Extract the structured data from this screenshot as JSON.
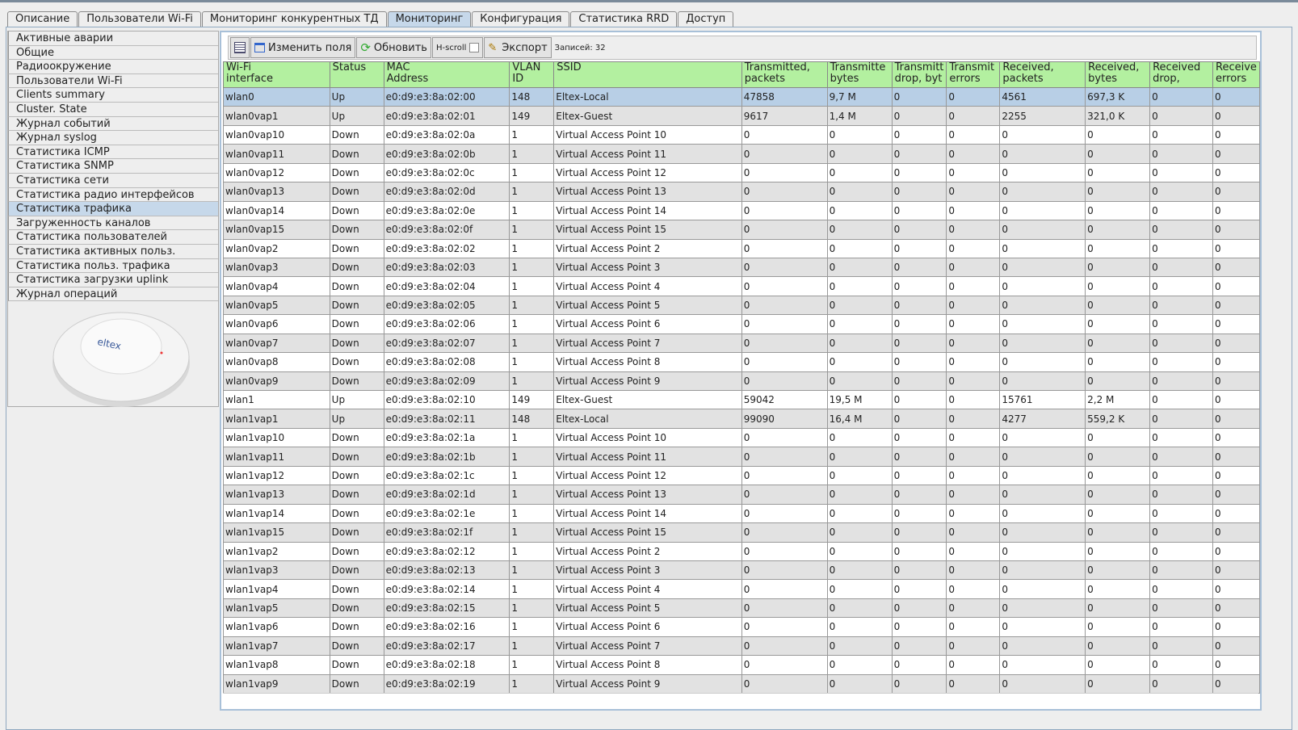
{
  "tabs": [
    "Описание",
    "Пользователи Wi-Fi",
    "Мониторинг конкурентных ТД",
    "Мониторинг",
    "Конфигурация",
    "Статистика RRD",
    "Доступ"
  ],
  "active_tab": 3,
  "sidebar": [
    "Активные аварии",
    "Общие",
    "Радиоокружение",
    "Пользователи Wi-Fi",
    "Clients summary",
    "Cluster. State",
    "Журнал событий",
    "Журнал syslog",
    "Статистика ICMP",
    "Статистика SNMP",
    "Статистика сети",
    "Статистика радио интерфейсов",
    "Статистика трафика",
    "Загруженность каналов",
    "Статистика пользователей",
    "Статистика активных польз.",
    "Статистика польз. трафика",
    "Статистика загрузки uplink",
    "Журнал операций"
  ],
  "sidebar_selected": 12,
  "device_logo": "ELTEX",
  "toolbar": {
    "edit_fields": "Изменить поля",
    "refresh": "Обновить",
    "hscroll": "H-scroll",
    "export": "Экспорт",
    "records": "Записей: 32"
  },
  "columns": [
    "Wi-Fi\ninterface",
    "Status",
    "MAC\nAddress",
    "VLAN\nID",
    "SSID",
    "Transmitted,\npackets",
    "Transmitte\nbytes",
    "Transmitt\ndrop, byt",
    "Transmit\nerrors",
    "Received,\npackets",
    "Received,\nbytes",
    "Received\ndrop,",
    "Receive\nerrors"
  ],
  "rows": [
    [
      "wlan0",
      "Up",
      "e0:d9:e3:8a:02:00",
      "148",
      "Eltex-Local",
      "47858",
      "9,7 M",
      "0",
      "0",
      "4561",
      "697,3 K",
      "0",
      "0"
    ],
    [
      "wlan0vap1",
      "Up",
      "e0:d9:e3:8a:02:01",
      "149",
      "Eltex-Guest",
      "9617",
      "1,4 M",
      "0",
      "0",
      "2255",
      "321,0 K",
      "0",
      "0"
    ],
    [
      "wlan0vap10",
      "Down",
      "e0:d9:e3:8a:02:0a",
      "1",
      "Virtual Access Point 10",
      "0",
      "0",
      "0",
      "0",
      "0",
      "0",
      "0",
      "0"
    ],
    [
      "wlan0vap11",
      "Down",
      "e0:d9:e3:8a:02:0b",
      "1",
      "Virtual Access Point 11",
      "0",
      "0",
      "0",
      "0",
      "0",
      "0",
      "0",
      "0"
    ],
    [
      "wlan0vap12",
      "Down",
      "e0:d9:e3:8a:02:0c",
      "1",
      "Virtual Access Point 12",
      "0",
      "0",
      "0",
      "0",
      "0",
      "0",
      "0",
      "0"
    ],
    [
      "wlan0vap13",
      "Down",
      "e0:d9:e3:8a:02:0d",
      "1",
      "Virtual Access Point 13",
      "0",
      "0",
      "0",
      "0",
      "0",
      "0",
      "0",
      "0"
    ],
    [
      "wlan0vap14",
      "Down",
      "e0:d9:e3:8a:02:0e",
      "1",
      "Virtual Access Point 14",
      "0",
      "0",
      "0",
      "0",
      "0",
      "0",
      "0",
      "0"
    ],
    [
      "wlan0vap15",
      "Down",
      "e0:d9:e3:8a:02:0f",
      "1",
      "Virtual Access Point 15",
      "0",
      "0",
      "0",
      "0",
      "0",
      "0",
      "0",
      "0"
    ],
    [
      "wlan0vap2",
      "Down",
      "e0:d9:e3:8a:02:02",
      "1",
      "Virtual Access Point 2",
      "0",
      "0",
      "0",
      "0",
      "0",
      "0",
      "0",
      "0"
    ],
    [
      "wlan0vap3",
      "Down",
      "e0:d9:e3:8a:02:03",
      "1",
      "Virtual Access Point 3",
      "0",
      "0",
      "0",
      "0",
      "0",
      "0",
      "0",
      "0"
    ],
    [
      "wlan0vap4",
      "Down",
      "e0:d9:e3:8a:02:04",
      "1",
      "Virtual Access Point 4",
      "0",
      "0",
      "0",
      "0",
      "0",
      "0",
      "0",
      "0"
    ],
    [
      "wlan0vap5",
      "Down",
      "e0:d9:e3:8a:02:05",
      "1",
      "Virtual Access Point 5",
      "0",
      "0",
      "0",
      "0",
      "0",
      "0",
      "0",
      "0"
    ],
    [
      "wlan0vap6",
      "Down",
      "e0:d9:e3:8a:02:06",
      "1",
      "Virtual Access Point 6",
      "0",
      "0",
      "0",
      "0",
      "0",
      "0",
      "0",
      "0"
    ],
    [
      "wlan0vap7",
      "Down",
      "e0:d9:e3:8a:02:07",
      "1",
      "Virtual Access Point 7",
      "0",
      "0",
      "0",
      "0",
      "0",
      "0",
      "0",
      "0"
    ],
    [
      "wlan0vap8",
      "Down",
      "e0:d9:e3:8a:02:08",
      "1",
      "Virtual Access Point 8",
      "0",
      "0",
      "0",
      "0",
      "0",
      "0",
      "0",
      "0"
    ],
    [
      "wlan0vap9",
      "Down",
      "e0:d9:e3:8a:02:09",
      "1",
      "Virtual Access Point 9",
      "0",
      "0",
      "0",
      "0",
      "0",
      "0",
      "0",
      "0"
    ],
    [
      "wlan1",
      "Up",
      "e0:d9:e3:8a:02:10",
      "149",
      "Eltex-Guest",
      "59042",
      "19,5 M",
      "0",
      "0",
      "15761",
      "2,2 M",
      "0",
      "0"
    ],
    [
      "wlan1vap1",
      "Up",
      "e0:d9:e3:8a:02:11",
      "148",
      "Eltex-Local",
      "99090",
      "16,4 M",
      "0",
      "0",
      "4277",
      "559,2 K",
      "0",
      "0"
    ],
    [
      "wlan1vap10",
      "Down",
      "e0:d9:e3:8a:02:1a",
      "1",
      "Virtual Access Point 10",
      "0",
      "0",
      "0",
      "0",
      "0",
      "0",
      "0",
      "0"
    ],
    [
      "wlan1vap11",
      "Down",
      "e0:d9:e3:8a:02:1b",
      "1",
      "Virtual Access Point 11",
      "0",
      "0",
      "0",
      "0",
      "0",
      "0",
      "0",
      "0"
    ],
    [
      "wlan1vap12",
      "Down",
      "e0:d9:e3:8a:02:1c",
      "1",
      "Virtual Access Point 12",
      "0",
      "0",
      "0",
      "0",
      "0",
      "0",
      "0",
      "0"
    ],
    [
      "wlan1vap13",
      "Down",
      "e0:d9:e3:8a:02:1d",
      "1",
      "Virtual Access Point 13",
      "0",
      "0",
      "0",
      "0",
      "0",
      "0",
      "0",
      "0"
    ],
    [
      "wlan1vap14",
      "Down",
      "e0:d9:e3:8a:02:1e",
      "1",
      "Virtual Access Point 14",
      "0",
      "0",
      "0",
      "0",
      "0",
      "0",
      "0",
      "0"
    ],
    [
      "wlan1vap15",
      "Down",
      "e0:d9:e3:8a:02:1f",
      "1",
      "Virtual Access Point 15",
      "0",
      "0",
      "0",
      "0",
      "0",
      "0",
      "0",
      "0"
    ],
    [
      "wlan1vap2",
      "Down",
      "e0:d9:e3:8a:02:12",
      "1",
      "Virtual Access Point 2",
      "0",
      "0",
      "0",
      "0",
      "0",
      "0",
      "0",
      "0"
    ],
    [
      "wlan1vap3",
      "Down",
      "e0:d9:e3:8a:02:13",
      "1",
      "Virtual Access Point 3",
      "0",
      "0",
      "0",
      "0",
      "0",
      "0",
      "0",
      "0"
    ],
    [
      "wlan1vap4",
      "Down",
      "e0:d9:e3:8a:02:14",
      "1",
      "Virtual Access Point 4",
      "0",
      "0",
      "0",
      "0",
      "0",
      "0",
      "0",
      "0"
    ],
    [
      "wlan1vap5",
      "Down",
      "e0:d9:e3:8a:02:15",
      "1",
      "Virtual Access Point 5",
      "0",
      "0",
      "0",
      "0",
      "0",
      "0",
      "0",
      "0"
    ],
    [
      "wlan1vap6",
      "Down",
      "e0:d9:e3:8a:02:16",
      "1",
      "Virtual Access Point 6",
      "0",
      "0",
      "0",
      "0",
      "0",
      "0",
      "0",
      "0"
    ],
    [
      "wlan1vap7",
      "Down",
      "e0:d9:e3:8a:02:17",
      "1",
      "Virtual Access Point 7",
      "0",
      "0",
      "0",
      "0",
      "0",
      "0",
      "0",
      "0"
    ],
    [
      "wlan1vap8",
      "Down",
      "e0:d9:e3:8a:02:18",
      "1",
      "Virtual Access Point 8",
      "0",
      "0",
      "0",
      "0",
      "0",
      "0",
      "0",
      "0"
    ],
    [
      "wlan1vap9",
      "Down",
      "e0:d9:e3:8a:02:19",
      "1",
      "Virtual Access Point 9",
      "0",
      "0",
      "0",
      "0",
      "0",
      "0",
      "0",
      "0"
    ]
  ],
  "selected_row": 0
}
